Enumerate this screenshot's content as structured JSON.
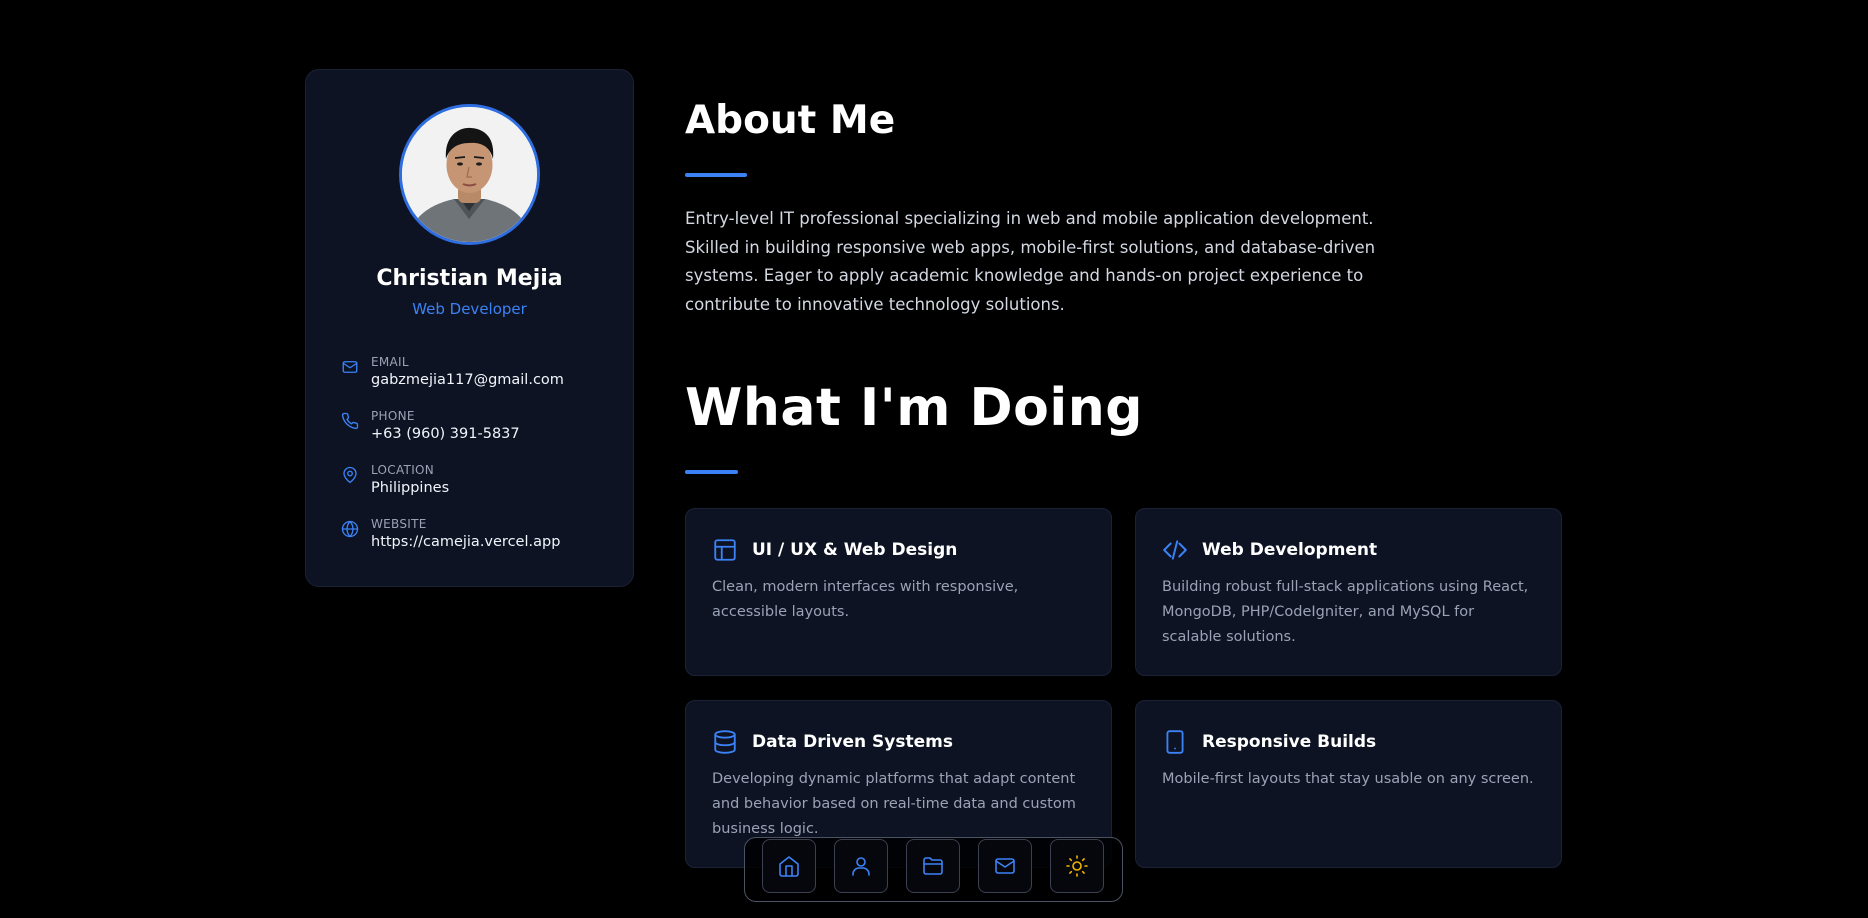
{
  "colors": {
    "accent": "#3b82f6",
    "background": "#000000",
    "card": "#0d1322",
    "sun": "#f5b400"
  },
  "profile": {
    "name": "Christian Mejia",
    "role": "Web Developer",
    "contacts": [
      {
        "icon": "mail-icon",
        "label": "EMAIL",
        "value": "gabzmejia117@gmail.com"
      },
      {
        "icon": "phone-icon",
        "label": "PHONE",
        "value": "+63 (960) 391-5837"
      },
      {
        "icon": "map-pin-icon",
        "label": "LOCATION",
        "value": "Philippines"
      },
      {
        "icon": "globe-icon",
        "label": "WEBSITE",
        "value": "https://camejia.vercel.app"
      }
    ]
  },
  "about": {
    "title": "About Me",
    "text": "Entry-level IT professional specializing in web and mobile application development. Skilled in building responsive web apps, mobile-first solutions, and database-driven systems. Eager to apply academic knowledge and hands-on project experience to contribute to innovative technology solutions."
  },
  "doing": {
    "title": "What I'm Doing",
    "services": [
      {
        "icon": "layout-icon",
        "title": "UI / UX & Web Design",
        "description": "Clean, modern interfaces with responsive, accessible layouts."
      },
      {
        "icon": "code-icon",
        "title": "Web Development",
        "description": "Building robust full-stack applications using React, MongoDB, PHP/CodeIgniter, and MySQL for scalable solutions."
      },
      {
        "icon": "database-icon",
        "title": "Data Driven Systems",
        "description": "Developing dynamic platforms that adapt content and behavior based on real-time data and custom business logic."
      },
      {
        "icon": "smartphone-icon",
        "title": "Responsive Builds",
        "description": "Mobile-first layouts that stay usable on any screen."
      }
    ]
  },
  "dock": {
    "items": [
      "home-icon",
      "user-icon",
      "folder-icon",
      "mail-icon",
      "sun-icon"
    ]
  }
}
